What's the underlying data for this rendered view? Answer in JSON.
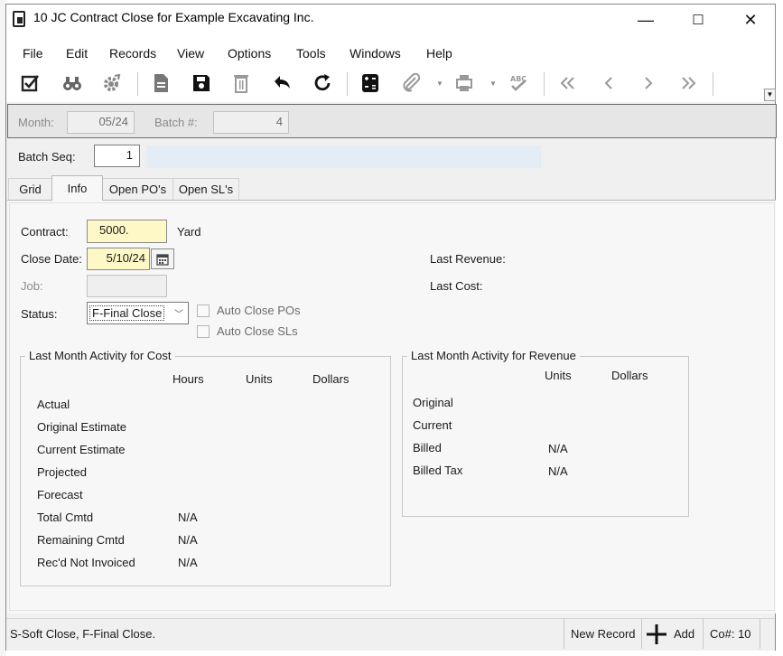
{
  "window": {
    "title": "10 JC Contract Close for Example Excavating Inc.",
    "controls": {
      "minimize": "—",
      "maximize": "☐",
      "close": "✕"
    }
  },
  "menu": [
    "File",
    "Edit",
    "Records",
    "View",
    "Options",
    "Tools",
    "Windows",
    "Help"
  ],
  "toolbar": {
    "icons": [
      "checkbox-edit-icon",
      "binoculars-search-icon",
      "gear-icon",
      "document-icon",
      "save-icon",
      "trash-icon",
      "undo-icon",
      "refresh-icon",
      "calculator-icon",
      "attachment-icon",
      "print-icon",
      "spellcheck-icon",
      "first-record-icon",
      "previous-record-icon",
      "next-record-icon",
      "last-record-icon"
    ],
    "spell_label": "ABC"
  },
  "header": {
    "month_label": "Month:",
    "month_value": "05/24",
    "batch_label": "Batch #:",
    "batch_value": "4"
  },
  "batch_seq": {
    "label": "Batch Seq:",
    "value": "1"
  },
  "tabs": [
    {
      "label": "Grid",
      "active": false
    },
    {
      "label": "Info",
      "active": true
    },
    {
      "label": "Open PO's",
      "active": false
    },
    {
      "label": "Open SL's",
      "active": false
    }
  ],
  "info": {
    "contract_label": "Contract:",
    "contract_value": "5000.",
    "contract_desc": "Yard",
    "close_date_label": "Close Date:",
    "close_date_value": "5/10/24",
    "job_label": "Job:",
    "job_value": "",
    "status_label": "Status:",
    "status_value": "F-Final Close",
    "auto_close_pos": "Auto Close POs",
    "auto_close_sls": "Auto Close SLs",
    "last_revenue_label": "Last Revenue:",
    "last_cost_label": "Last Cost:"
  },
  "cost_group": {
    "title": "Last Month Activity for Cost",
    "columns": [
      "Hours",
      "Units",
      "Dollars"
    ],
    "rows": [
      {
        "label": "Actual",
        "hours": ""
      },
      {
        "label": "Original Estimate",
        "hours": ""
      },
      {
        "label": "Current Estimate",
        "hours": ""
      },
      {
        "label": "Projected",
        "hours": ""
      },
      {
        "label": "Forecast",
        "hours": ""
      },
      {
        "label": "Total Cmtd",
        "hours": "N/A"
      },
      {
        "label": "Remaining Cmtd",
        "hours": "N/A"
      },
      {
        "label": "Rec'd Not Invoiced",
        "hours": "N/A"
      }
    ]
  },
  "revenue_group": {
    "title": "Last Month Activity for Revenue",
    "columns": [
      "Units",
      "Dollars"
    ],
    "rows": [
      {
        "label": "Original",
        "units": ""
      },
      {
        "label": "Current",
        "units": ""
      },
      {
        "label": "Billed",
        "units": "N/A"
      },
      {
        "label": "Billed Tax",
        "units": "N/A"
      }
    ]
  },
  "status_bar": {
    "message": "S-Soft Close, F-Final Close.",
    "record_state": "New Record",
    "add_label": "Add",
    "company": "Co#: 10"
  },
  "colors": {
    "required_field": "#fdf8c5",
    "window_bg": "#f0f0f0",
    "panel_bg": "#f7f7f7"
  }
}
